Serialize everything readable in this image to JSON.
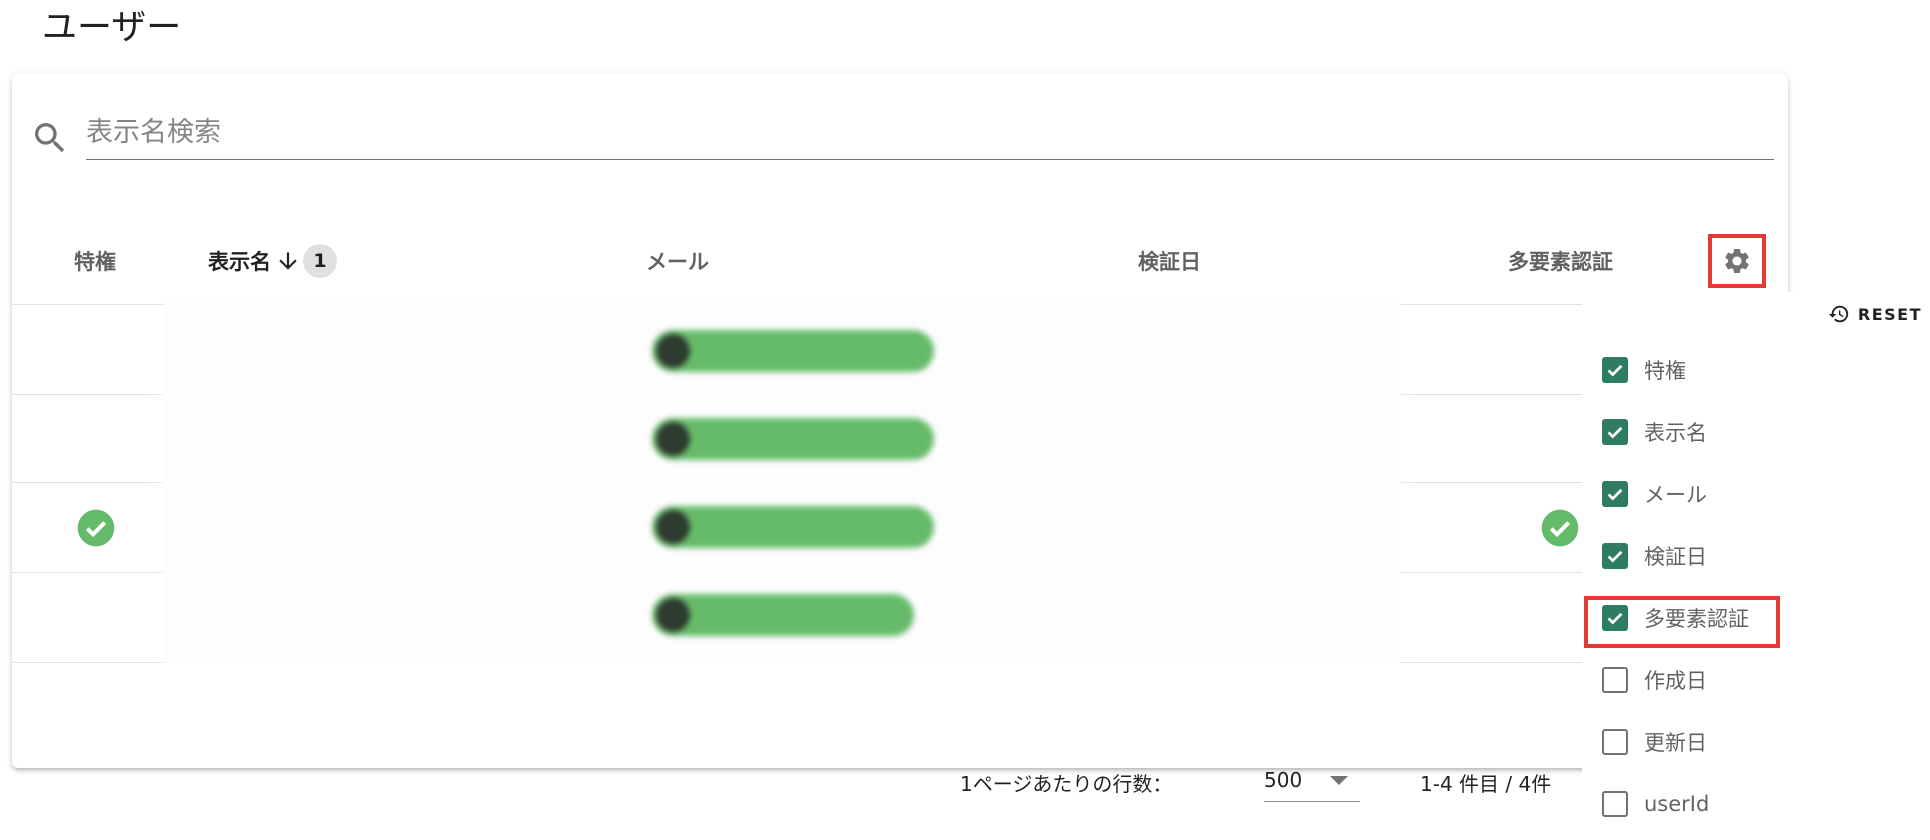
{
  "page": {
    "title": "ユーザー"
  },
  "search": {
    "placeholder": "表示名検索",
    "value": ""
  },
  "table": {
    "columns": [
      {
        "key": "privilege",
        "label": "特権"
      },
      {
        "key": "display_name",
        "label": "表示名",
        "sorted": "desc",
        "sort_order": "1"
      },
      {
        "key": "mail",
        "label": "メール"
      },
      {
        "key": "verified_date",
        "label": "検証日"
      },
      {
        "key": "mfa",
        "label": "多要素認証"
      }
    ],
    "rows": [
      {
        "privilege": false,
        "display_name": "",
        "mail": "",
        "verified_date": "",
        "mfa": false
      },
      {
        "privilege": false,
        "display_name": "",
        "mail": "",
        "verified_date": "",
        "mfa": false
      },
      {
        "privilege": true,
        "display_name": "",
        "mail": "",
        "verified_date": "",
        "mfa": true
      },
      {
        "privilege": false,
        "display_name": "",
        "mail": "",
        "verified_date": "",
        "mfa": false
      }
    ]
  },
  "footer": {
    "rows_per_page_label": "1ページあたりの行数：",
    "rows_per_page_value": "500",
    "range_text": "1-4 件目 / 4件"
  },
  "column_menu": {
    "reset_label": "RESET",
    "items": [
      {
        "label": "特権",
        "checked": true
      },
      {
        "label": "表示名",
        "checked": true
      },
      {
        "label": "メール",
        "checked": true
      },
      {
        "label": "検証日",
        "checked": true
      },
      {
        "label": "多要素認証",
        "checked": true
      },
      {
        "label": "作成日",
        "checked": false
      },
      {
        "label": "更新日",
        "checked": false
      },
      {
        "label": "userId",
        "checked": false
      }
    ]
  },
  "colors": {
    "accent_green": "#2e7d63",
    "check_green": "#66bb6a",
    "highlight_red": "#e53935"
  }
}
